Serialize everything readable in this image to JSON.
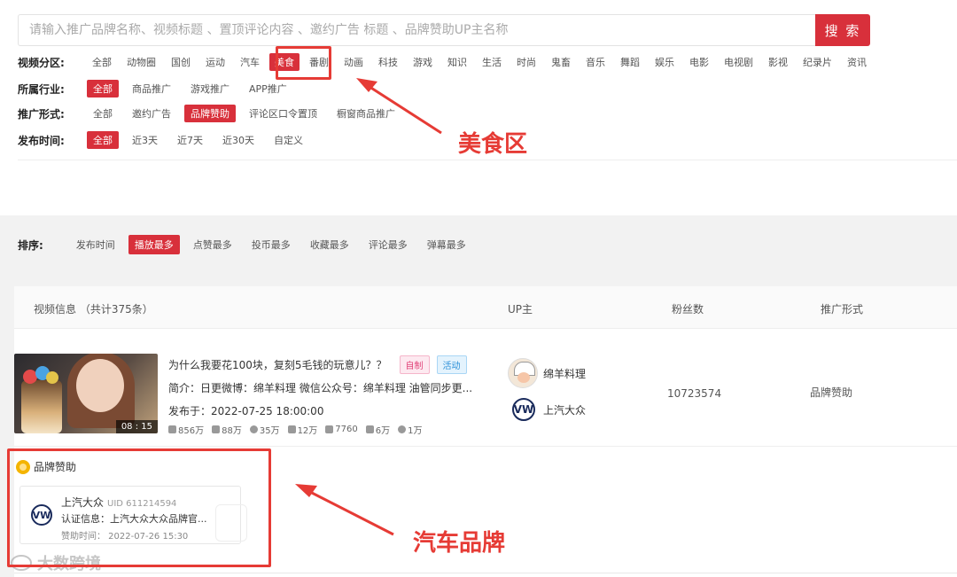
{
  "search": {
    "placeholder": "请输入推广品牌名称、视频标题 、置顶评论内容 、邀约广告 标题 、品牌赞助UP主名称",
    "button": "搜 索"
  },
  "filters": {
    "zone": {
      "label": "视频分区:",
      "options": [
        "全部",
        "动物圈",
        "国创",
        "运动",
        "汽车",
        "美食",
        "番剧",
        "动画",
        "科技",
        "游戏",
        "知识",
        "生活",
        "时尚",
        "鬼畜",
        "音乐",
        "舞蹈",
        "娱乐",
        "电影",
        "电视剧",
        "影视",
        "纪录片",
        "资讯"
      ],
      "active": 5
    },
    "industry": {
      "label": "所属行业:",
      "options": [
        "全部",
        "商品推广",
        "游戏推广",
        "APP推广"
      ],
      "active": 0
    },
    "promo": {
      "label": "推广形式:",
      "options": [
        "全部",
        "邀约广告",
        "品牌赞助",
        "评论区口令置顶",
        "橱窗商品推广"
      ],
      "active": 2
    },
    "time": {
      "label": "发布时间:",
      "options": [
        "全部",
        "近3天",
        "近7天",
        "近30天",
        "自定义"
      ],
      "active": 0
    }
  },
  "annotations": {
    "food": "美食区",
    "car": "汽车品牌",
    "color": "#e63b35"
  },
  "sort": {
    "label": "排序:",
    "options": [
      "发布时间",
      "播放最多",
      "点赞最多",
      "投币最多",
      "收藏最多",
      "评论最多",
      "弹幕最多"
    ],
    "active": 1
  },
  "table": {
    "headers": {
      "info": "视频信息 （共计375条）",
      "up": "UP主",
      "fans": "粉丝数",
      "type": "推广形式"
    }
  },
  "video": {
    "title": "为什么我要花100块，复刻5毛钱的玩意儿？？",
    "tag_self": "自制",
    "tag_activity": "活动",
    "desc": "简介：日更微博：绵羊料理 微信公众号：绵羊料理 油管同步更...",
    "date": "发布于：2022-07-25 18:00:00",
    "duration": "08 : 15",
    "stats": {
      "play": "856万",
      "like": "88万",
      "coin": "35万",
      "fav": "12万",
      "comment": "7760",
      "danmaku": "6万",
      "share": "1万"
    },
    "up_name": "绵羊料理",
    "sponsor_name": "上汽大众",
    "fans": "10723574",
    "promo_type": "品牌赞助"
  },
  "sponsor_card": {
    "title": "品牌赞助",
    "name": "上汽大众",
    "uid": "UID 611214594",
    "auth": "认证信息：上汽大众大众品牌官...",
    "time": "赞助时间：  2022-07-26 15:30",
    "logo": "VW"
  },
  "watermark": "大数跨境",
  "colors": {
    "accent": "#d8303b"
  }
}
